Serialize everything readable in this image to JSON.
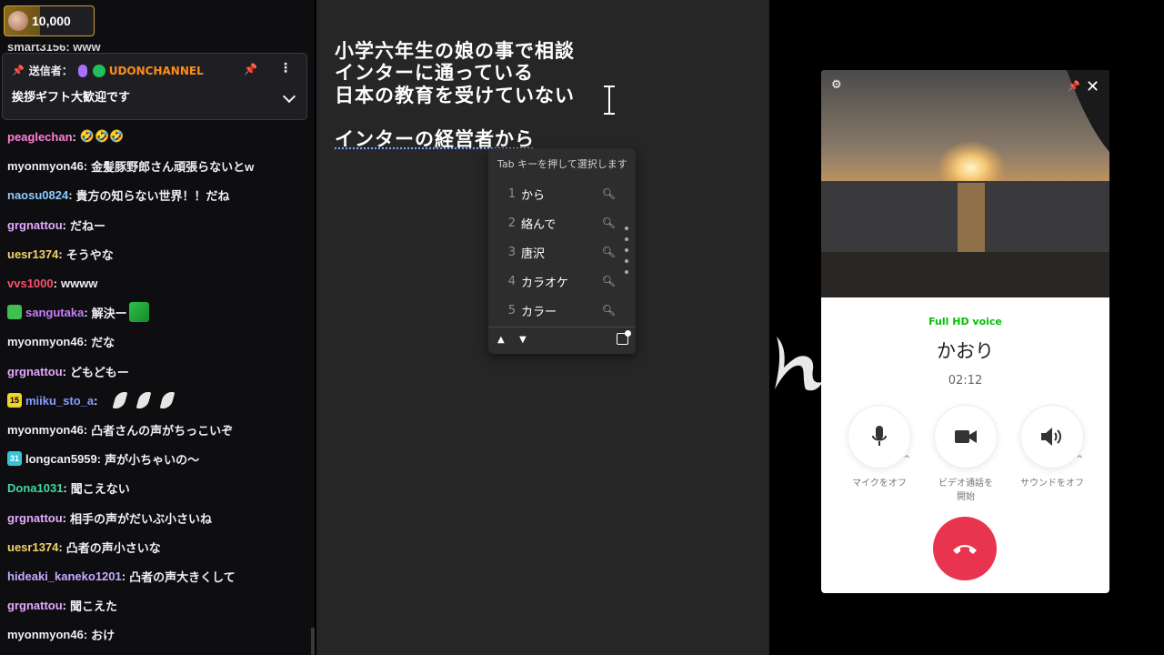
{
  "chat": {
    "points": "10,000",
    "cut_line": "smart3156: www",
    "pinned": {
      "sender_label": "送信者：",
      "channel": "UDONCHANNEL",
      "message": "挨拶ギフト大歓迎です"
    },
    "messages": [
      {
        "user": "peaglechan",
        "color": "#ff7fd9",
        "text": "🤣🤣🤣",
        "badge": ""
      },
      {
        "user": "myonmyon46",
        "color": "#efeff1",
        "text": "金髪豚野郎さん頑張らないとw",
        "badge": ""
      },
      {
        "user": "naosu0824",
        "color": "#8ecbff",
        "text": "貴方の知らない世界！！だね",
        "badge": ""
      },
      {
        "user": "grgnattou",
        "color": "#e6a8ff",
        "text": "だねー",
        "badge": ""
      },
      {
        "user": "uesr1374",
        "color": "#f2d36a",
        "text": "そうやな",
        "badge": ""
      },
      {
        "user": "vvs1000",
        "color": "#ff4f6d",
        "text": "wwww",
        "badge": ""
      },
      {
        "user": "sangutaka",
        "color": "#c77dff",
        "text": "解決ー",
        "badge": "gift"
      },
      {
        "user": "myonmyon46",
        "color": "#efeff1",
        "text": "だな",
        "badge": ""
      },
      {
        "user": "grgnattou",
        "color": "#e6a8ff",
        "text": "どもどもー",
        "badge": ""
      },
      {
        "user": "miiku_sto_a",
        "color": "#8a9bff",
        "text": "",
        "badge": "15"
      },
      {
        "user": "myonmyon46",
        "color": "#efeff1",
        "text": "凸者さんの声がちっこいぞ",
        "badge": ""
      },
      {
        "user": "longcan5959",
        "color": "#efeff1",
        "text": "声が小ちゃいの〜",
        "badge": "31"
      },
      {
        "user": "Dona1031",
        "color": "#3fd8a4",
        "text": "聞こえない",
        "badge": ""
      },
      {
        "user": "grgnattou",
        "color": "#e6a8ff",
        "text": "相手の声がだいぶ小さいね",
        "badge": ""
      },
      {
        "user": "uesr1374",
        "color": "#f2d36a",
        "text": "凸者の声小さいな",
        "badge": ""
      },
      {
        "user": "hideaki_kaneko1201",
        "color": "#c9a8ff",
        "text": "凸者の声大きくして",
        "badge": ""
      },
      {
        "user": "grgnattou",
        "color": "#e6a8ff",
        "text": "聞こえた",
        "badge": ""
      },
      {
        "user": "myonmyon46",
        "color": "#efeff1",
        "text": "おけ",
        "badge": ""
      }
    ]
  },
  "editor": {
    "lines": [
      "小学六年生の娘の事で相談",
      "インターに通っている",
      "日本の教育を受けていない",
      "インターの経営者から"
    ]
  },
  "ime": {
    "hint": "Tab キーを押して選択します",
    "candidates": [
      {
        "num": "1",
        "word": "から"
      },
      {
        "num": "2",
        "word": "絡んで"
      },
      {
        "num": "3",
        "word": "唐沢"
      },
      {
        "num": "4",
        "word": "カラオケ"
      },
      {
        "num": "5",
        "word": "カラー"
      }
    ]
  },
  "call": {
    "quality": "Full HD voice",
    "name": "かおり",
    "timer": "02:12",
    "mic_label": "マイクをオフ",
    "video_label_1": "ビデオ通話を",
    "video_label_2": "開始",
    "sound_label": "サウンドをオフ",
    "hangup_color": "#e8344e"
  }
}
